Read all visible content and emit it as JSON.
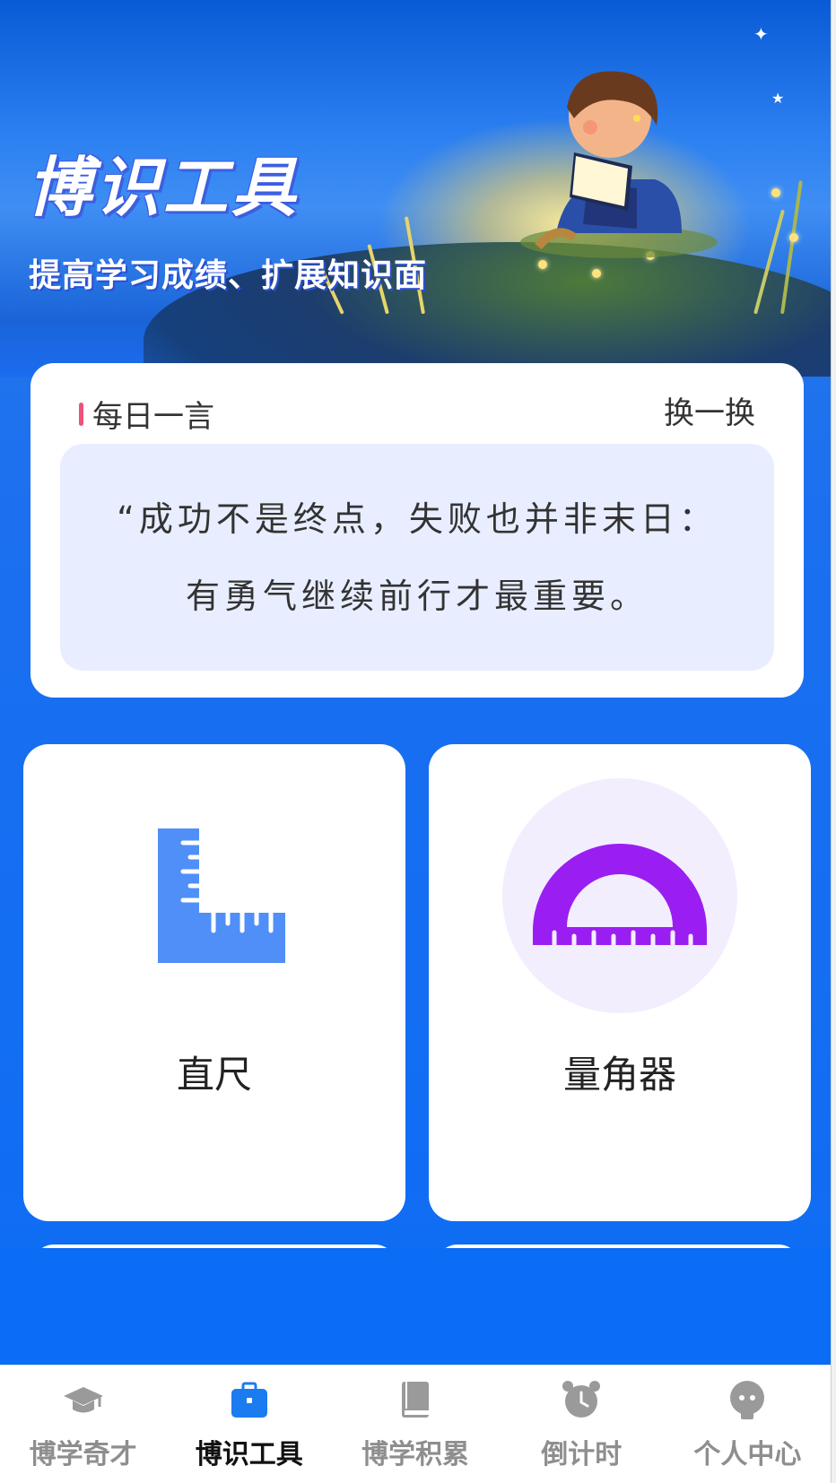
{
  "banner": {
    "title": "博识工具",
    "subtitle": "提高学习成绩、扩展知识面"
  },
  "quote": {
    "title": "每日一言",
    "switch_label": "换一换",
    "line1": "“成功不是终点，失败也并非末日：",
    "line2": "有勇气继续前行才最重要。"
  },
  "tools": [
    {
      "label": "直尺",
      "icon": "ruler-icon",
      "color": "#4f8ff7"
    },
    {
      "label": "量角器",
      "icon": "protractor-icon",
      "color": "#9a1ef2",
      "bg": "#f3eefe"
    }
  ],
  "tabbar": {
    "active_index": 1,
    "items": [
      {
        "label": "博学奇才",
        "icon": "graduation-cap-icon"
      },
      {
        "label": "博识工具",
        "icon": "toolbox-icon"
      },
      {
        "label": "博学积累",
        "icon": "book-icon"
      },
      {
        "label": "倒计时",
        "icon": "alarm-clock-icon"
      },
      {
        "label": "个人中心",
        "icon": "user-icon"
      }
    ]
  },
  "colors": {
    "primary_blue": "#0b6cf5",
    "quote_accent": "#f0517a",
    "quote_bg": "#e8eeff",
    "tab_inactive": "#8e8e8e",
    "tab_active_icon": "#1a7cf0"
  }
}
